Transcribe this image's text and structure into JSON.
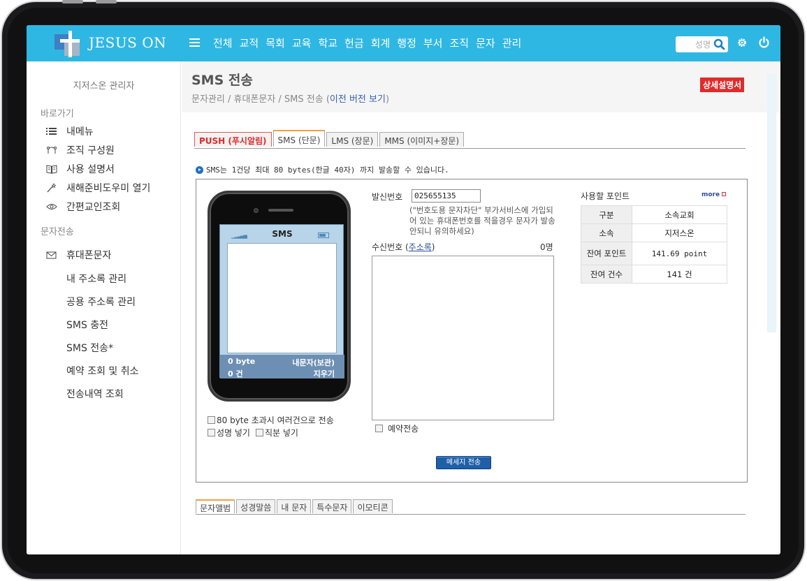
{
  "app": {
    "logo_text": "JESUS ON"
  },
  "nav": {
    "items": [
      "전체",
      "교적",
      "목회",
      "교육",
      "학교",
      "헌금",
      "회계",
      "행정",
      "부서",
      "조직",
      "문자",
      "관리"
    ],
    "search_placeholder": "성명"
  },
  "sidebar": {
    "admin_name": "지저스온 관리자",
    "shortcut_heading": "바로가기",
    "shortcuts": [
      {
        "label": "내메뉴",
        "icon": "list-icon"
      },
      {
        "label": "조직 구성원",
        "icon": "org-icon"
      },
      {
        "label": "사용 설명서",
        "icon": "book-icon"
      },
      {
        "label": "새해준비도우미 열기",
        "icon": "wand-icon"
      },
      {
        "label": "간편교인조회",
        "icon": "eye-icon"
      }
    ],
    "sms_heading": "문자전송",
    "sms_main": {
      "label": "휴대폰문자",
      "icon": "mail-icon"
    },
    "sms_items": [
      "내 주소록 관리",
      "공용 주소록 관리",
      "SMS 충전",
      "SMS 전송*",
      "예약 조회 및 취소",
      "전송내역 조회"
    ]
  },
  "page": {
    "title": "SMS 전송",
    "breadcrumb": "문자관리 / 휴대폰문자 / SMS 전송 (",
    "breadcrumb_link": "이전 버전 보기",
    "breadcrumb_end": ")",
    "manual_button": "상세설명서"
  },
  "tabs": [
    "PUSH (푸시알림)",
    "SMS (단문)",
    "LMS (장문)",
    "MMS (이미지+장문)"
  ],
  "active_tab": "SMS (단문)",
  "notice": "SMS는 1건당 최대 80 bytes(한글 40자) 까지 발송할 수 있습니다.",
  "phone": {
    "title": "SMS",
    "bytes": "0 byte",
    "count": "0 건",
    "save_label": "내문자(보관)",
    "clear_label": "지우기"
  },
  "options": {
    "split_label": "80 byte 초과시 여러건으로 전송",
    "name_label": "성명 넣기",
    "position_label": "직분 넣기",
    "reserve_label": "예약전송"
  },
  "sender": {
    "label": "발신번호",
    "value": "025655135",
    "note": "(\"번호도용 문자차단\" 부가서비스에 가입되어 있는 휴대폰번호를 적을경우 문자가 발송 안되니 유의하세요)"
  },
  "receiver": {
    "label": "수신번호 (",
    "link": "주소록",
    "label_end": ")",
    "count": "0명"
  },
  "send_button": "메세지 전송",
  "points": {
    "heading": "사용할 포인트",
    "more": "more",
    "rows": [
      {
        "key": "구분",
        "value": "소속교회"
      },
      {
        "key": "소속",
        "value": "지저스온"
      },
      {
        "key": "잔여 포인트",
        "value": "141.69 point"
      },
      {
        "key": "잔여 건수",
        "value": "141 건"
      }
    ]
  },
  "bottom_tabs": [
    "문자앨범",
    "성경말씀",
    "내 문자",
    "특수문자",
    "이모티콘"
  ]
}
